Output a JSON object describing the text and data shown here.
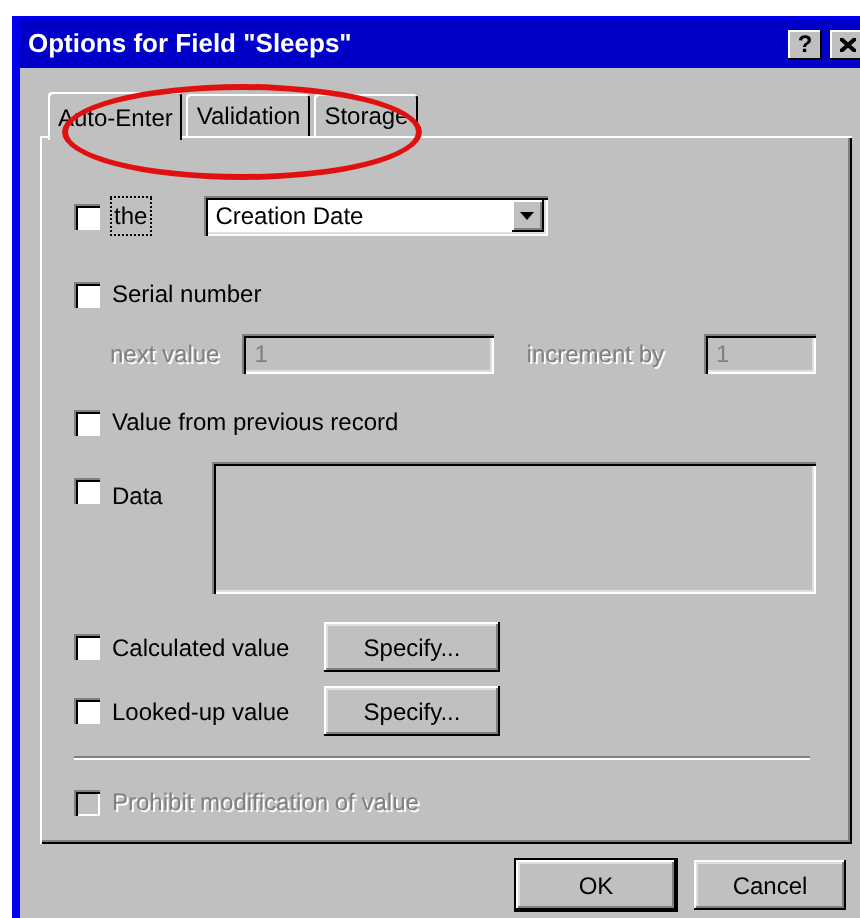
{
  "window": {
    "title": "Options for Field \"Sleeps\"",
    "help": "?"
  },
  "tabs": [
    {
      "label": "Auto-Enter",
      "selected": true,
      "circled": false
    },
    {
      "label": "Validation",
      "selected": false,
      "circled": true
    },
    {
      "label": "Storage",
      "selected": false,
      "circled": false
    }
  ],
  "options": [
    {
      "kind": "dropdown",
      "label": "the",
      "checked": false,
      "focused": true,
      "value": "Creation Date"
    },
    {
      "kind": "serial",
      "label": "Serial number",
      "checked": false,
      "next_label": "next value",
      "next_value": "1",
      "increment_label": "increment by",
      "increment_value": "1",
      "disabled": true
    },
    {
      "kind": "plain",
      "label": "Value from previous record",
      "checked": false
    },
    {
      "kind": "data",
      "label": "Data",
      "checked": false
    },
    {
      "kind": "specify",
      "label": "Calculated value",
      "checked": false,
      "button": "Specify..."
    },
    {
      "kind": "specify",
      "label": "Looked-up value",
      "checked": false,
      "button": "Specify..."
    }
  ],
  "prohibit": {
    "label": "Prohibit modification of value",
    "checked": false,
    "disabled": true
  },
  "buttons": [
    {
      "label": "OK",
      "default": true
    },
    {
      "label": "Cancel",
      "default": false
    }
  ]
}
